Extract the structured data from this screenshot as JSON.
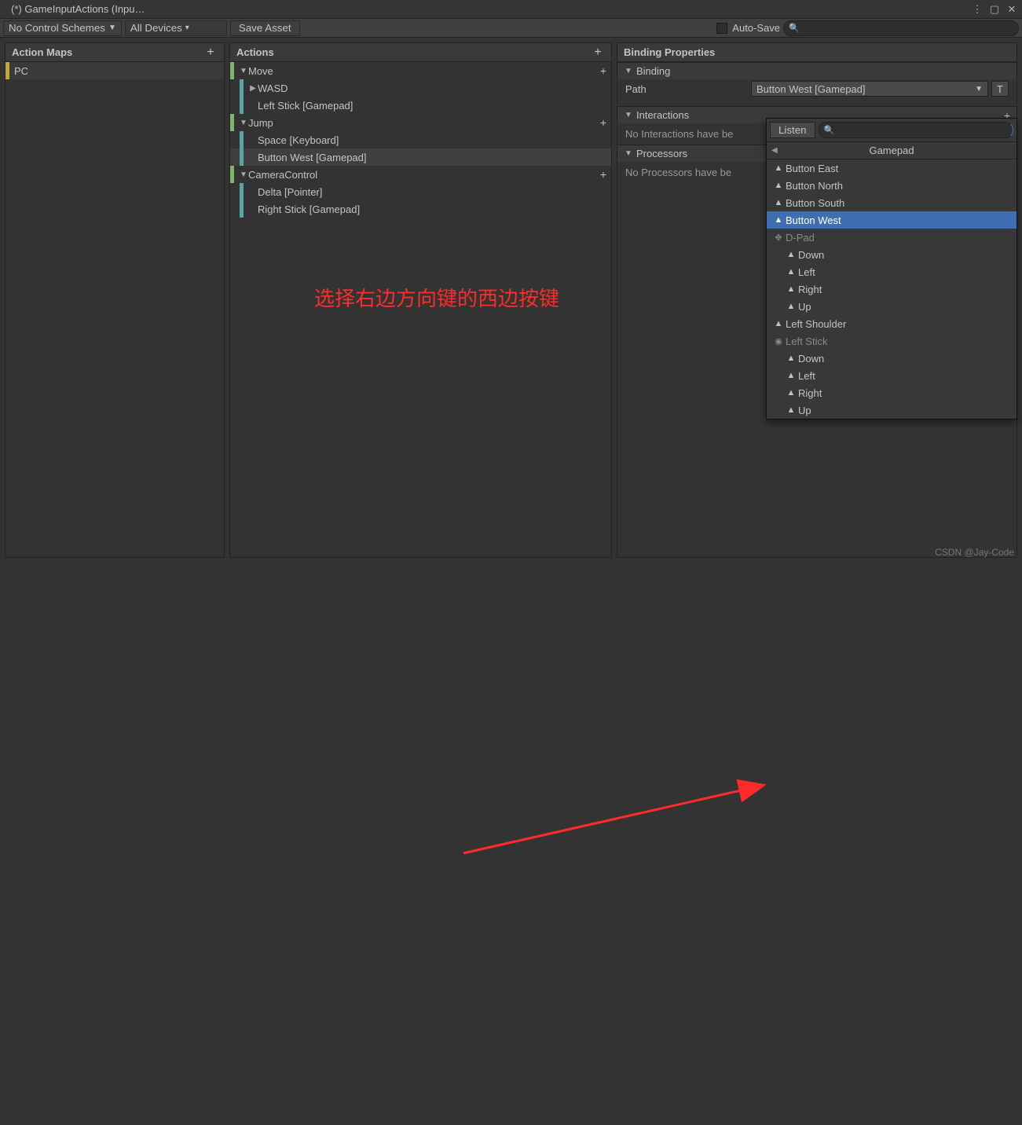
{
  "window": {
    "title": "(*) GameInputActions (Inpu…"
  },
  "toolbar": {
    "schemes": "No Control Schemes",
    "devices": "All Devices",
    "save": "Save Asset",
    "autosave": "Auto-Save",
    "search_placeholder": ""
  },
  "cols": {
    "maps_title": "Action Maps",
    "actions_title": "Actions",
    "props_title": "Binding Properties"
  },
  "maps": {
    "items": [
      {
        "label": "PC"
      }
    ]
  },
  "actions": [
    {
      "type": "action",
      "label": "Move",
      "fold": "▼"
    },
    {
      "type": "composite",
      "label": "WASD",
      "fold": "▶"
    },
    {
      "type": "binding",
      "label": "Left Stick [Gamepad]"
    },
    {
      "type": "action",
      "label": "Jump",
      "fold": "▼"
    },
    {
      "type": "binding",
      "label": "Space [Keyboard]"
    },
    {
      "type": "binding",
      "label": "Button West [Gamepad]",
      "selected": true
    },
    {
      "type": "action",
      "label": "CameraControl",
      "fold": "▼"
    },
    {
      "type": "binding",
      "label": "Delta [Pointer]"
    },
    {
      "type": "binding",
      "label": "Right Stick [Gamepad]"
    }
  ],
  "props": {
    "binding_section": "Binding",
    "path_label": "Path",
    "path_value": "Button West [Gamepad]",
    "t_label": "T",
    "interactions_section": "Interactions",
    "interactions_empty": "No Interactions have be",
    "processors_section": "Processors",
    "processors_empty": "No Processors have be"
  },
  "popup": {
    "listen": "Listen",
    "category": "Gamepad",
    "items": [
      {
        "label": "Button East",
        "indent": 1,
        "icon": "▲"
      },
      {
        "label": "Button North",
        "indent": 1,
        "icon": "▲"
      },
      {
        "label": "Button South",
        "indent": 1,
        "icon": "▲"
      },
      {
        "label": "Button West",
        "indent": 1,
        "icon": "▲",
        "selected": true
      },
      {
        "label": "D-Pad",
        "indent": 1,
        "icon": "✥",
        "cat": true
      },
      {
        "label": "Down",
        "indent": 2,
        "icon": "▲"
      },
      {
        "label": "Left",
        "indent": 2,
        "icon": "▲"
      },
      {
        "label": "Right",
        "indent": 2,
        "icon": "▲"
      },
      {
        "label": "Up",
        "indent": 2,
        "icon": "▲"
      },
      {
        "label": "Left Shoulder",
        "indent": 1,
        "icon": "▲"
      },
      {
        "label": "Left Stick",
        "indent": 1,
        "icon": "◉",
        "cat": true
      },
      {
        "label": "Down",
        "indent": 2,
        "icon": "▲"
      },
      {
        "label": "Left",
        "indent": 2,
        "icon": "▲"
      },
      {
        "label": "Right",
        "indent": 2,
        "icon": "▲"
      },
      {
        "label": "Up",
        "indent": 2,
        "icon": "▲"
      }
    ]
  },
  "annotation": "选择右边方向键的西边按键",
  "watermark": "CSDN @Jay-Code"
}
